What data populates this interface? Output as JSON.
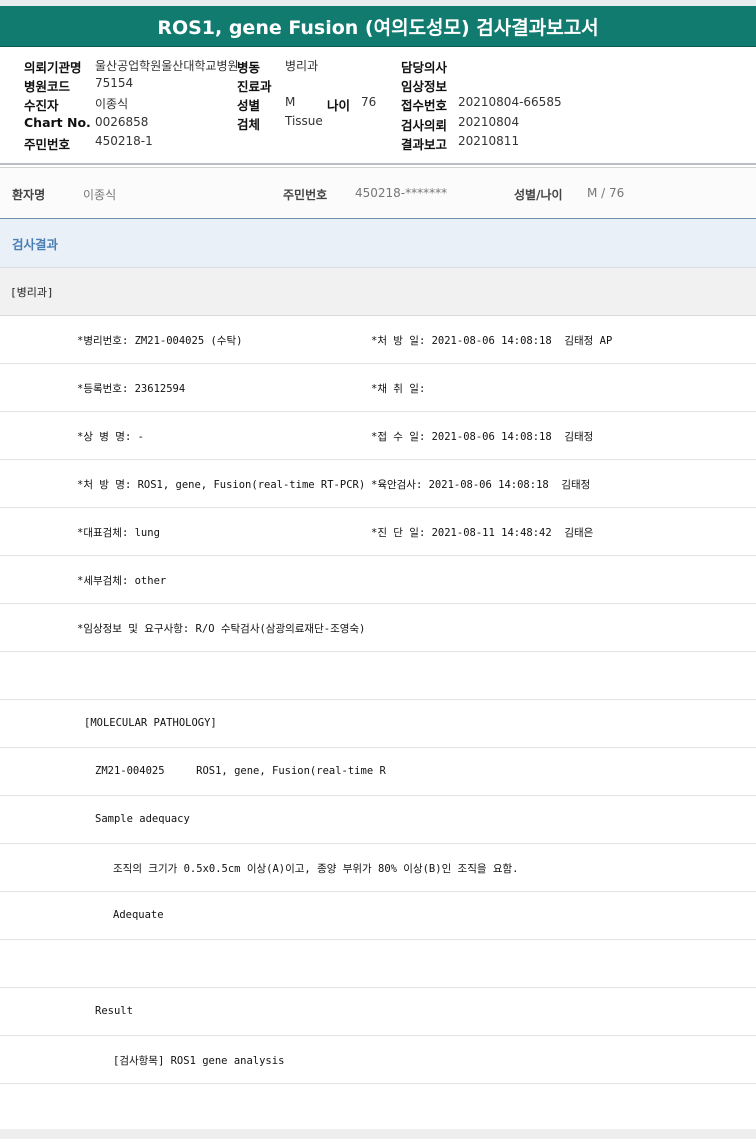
{
  "header": {
    "title": "ROS1, gene Fusion (여의도성모) 검사결과보고서"
  },
  "info": {
    "hospital_label": "의뢰기관명",
    "hospital_value": "울산공업학원울산대학교병원",
    "ward_label": "병동",
    "ward_value": "병리과",
    "doctor_label": "담당의사",
    "doctor_value": "",
    "code_label": "병원코드",
    "code_value": "75154",
    "dept_label": "진료과",
    "dept_value": "",
    "clinical_label": "임상정보",
    "clinical_value": "",
    "recipient_label": "수진자",
    "recipient_value": "이종식",
    "sex_label": "성별",
    "sex_value": "M",
    "age_label": "나이",
    "age_value": "76",
    "receipt_label": "접수번호",
    "receipt_value": "20210804-66585",
    "chart_label": "Chart No.",
    "chart_value": "0026858",
    "specimen_label": "검체",
    "specimen_value": "Tissue",
    "request_label": "검사의뢰",
    "request_value": "20210804",
    "rrn_label": "주민번호",
    "rrn_value": "450218-1",
    "report_label": "결과보고",
    "report_value": "20210811"
  },
  "patient": {
    "name_label": "환자명",
    "name_value": "이종식",
    "rrn_label": "주민번호",
    "rrn_value": "450218-*******",
    "sexage_label": "성별/나이",
    "sexage_value": "M / 76"
  },
  "result": {
    "section_title": "검사결과",
    "dept_tag": "[병리과]",
    "rows": [
      {
        "left": "*병리번호: ZM21-004025 (수탁)",
        "right": "*처 방 일: 2021-08-06 14:08:18  김태정 AP"
      },
      {
        "left": "*등록번호: 23612594",
        "right": "*채 취 일:"
      },
      {
        "left": "*상 병 명: -",
        "right": "*접 수 일: 2021-08-06 14:08:18  김태정"
      },
      {
        "left": "*처 방 명: ROS1, gene, Fusion(real-time RT-PCR)",
        "right": "*육안검사: 2021-08-06 14:08:18  김태정"
      },
      {
        "left": "*대표검체: lung",
        "right": "*진 단 일: 2021-08-11 14:48:42  김태은"
      },
      {
        "left": "*세부검체: other",
        "right": ""
      },
      {
        "left": "*임상정보 및 요구사항: R/O 수탁검사(삼광의료재단-조영숙)",
        "right": ""
      },
      {
        "left": "",
        "right": ""
      },
      {
        "left": "[MOLECULAR PATHOLOGY]",
        "right": ""
      },
      {
        "left": "ZM21-004025     ROS1, gene, Fusion(real-time R",
        "right": ""
      },
      {
        "left": "Sample adequacy",
        "right": ""
      },
      {
        "left": "조직의 크기가 0.5x0.5cm 이상(A)이고, 종양 부위가 80% 이상(B)인 조직을 요함.",
        "right": ""
      },
      {
        "left": "Adequate",
        "right": ""
      },
      {
        "left": "",
        "right": ""
      },
      {
        "left": "Result",
        "right": ""
      },
      {
        "left": "[검사항목] ROS1 gene analysis",
        "right": ""
      }
    ]
  }
}
